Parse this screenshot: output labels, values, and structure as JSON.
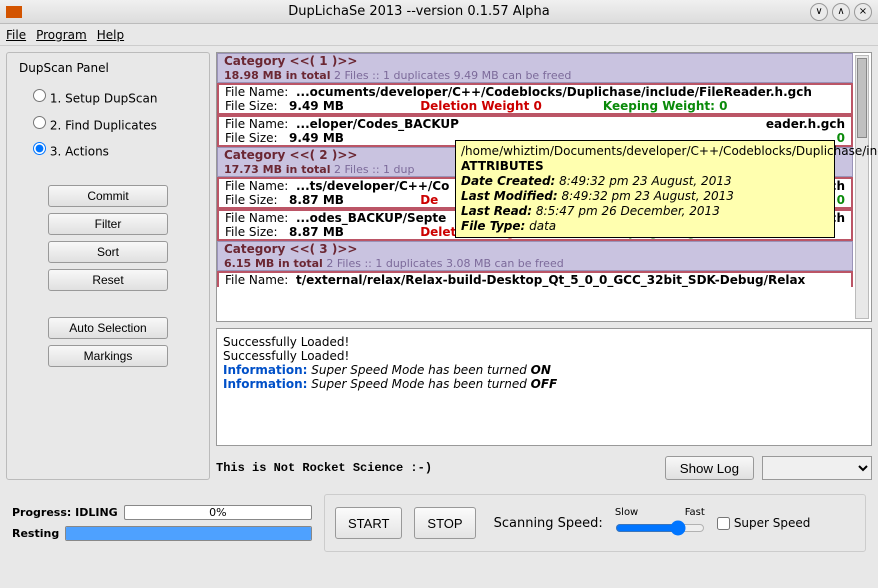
{
  "window": {
    "title": "DupLichaSe 2013 --version 0.1.57 Alpha"
  },
  "menu": {
    "file": "File",
    "program": "Program",
    "help": "Help"
  },
  "sidebar": {
    "title": "DupScan Panel",
    "r1": "1. Setup DupScan",
    "r2": "2. Find Duplicates",
    "r3": "3. Actions",
    "commit": "Commit",
    "filter": "Filter",
    "sort": "Sort",
    "reset": "Reset",
    "auto": "Auto Selection",
    "markings": "Markings"
  },
  "results": {
    "cat1_head": "Category <<( 1 )>>",
    "cat1_total": "18.98 MB in total",
    "cat1_tail": "  2 Files ::  1 duplicates   9.49 MB can be freed",
    "row1_path": "...ocuments/developer/C++/Codeblocks/Duplichase/include/FileReader.h.gch",
    "row1_size": "9.49 MB",
    "row2_path": "...eloper/Codes_BACKUP",
    "row2_size": "9.49 MB",
    "row2_tail": "eader.h.gch",
    "cat2_head": "Category <<( 2 )>>",
    "cat2_total": "17.73 MB in total",
    "cat2_tail": "  2 Files ::  1 dup",
    "row3_path": "...ts/developer/C++/Co",
    "row3_size": "8.87 MB",
    "row3_tail": "hash.h.gch",
    "row4_path": "...odes_BACKUP/Septe",
    "row4_size": "8.87 MB",
    "row4_tail": "hash.h.gch",
    "cat3_head": "Category <<( 3 )>>",
    "cat3_total": "6.15 MB in total",
    "cat3_tail": "  2 Files ::  1 duplicates   3.08 MB can be freed",
    "row5_path": "t/external/relax/Relax-build-Desktop_Qt_5_0_0_GCC_32bit_SDK-Debug/Relax",
    "filename_label": "File Name:",
    "filesize_label": "File Size:",
    "delw": "Deletion Weight  0",
    "keepw": "Keeping Weight:  0"
  },
  "log": {
    "l1": "Successfully Loaded!",
    "l2": "Successfully Loaded!",
    "info_label": "Information:",
    "i1": " Super Speed Mode has been turned ",
    "on": "ON",
    "i2": " Super Speed Mode has been turned ",
    "off": "OFF",
    "tagline": "This is Not Rocket Science :-)",
    "showlog": "Show Log"
  },
  "bottom": {
    "progress_label": "Progress: IDLING",
    "progress_pct": "0%",
    "resting": "Resting",
    "start": "START",
    "stop": "STOP",
    "speed_label": "Scanning Speed:",
    "slow": "Slow",
    "fast": "Fast",
    "superspeed": "Super Speed"
  },
  "tooltip": {
    "path": "/home/whiztim/Documents/developer/C++/Codeblocks/Duplichase/include/FileReader.h.gch",
    "attrs": "ATTRIBUTES",
    "dc_l": "Date Created:",
    "dc_v": " 8:49:32 pm 23 August, 2013",
    "lm_l": "Last Modified:",
    "lm_v": " 8:49:32 pm 23 August, 2013",
    "lr_l": "Last Read:",
    "lr_v": " 8:5:47 pm 26 December, 2013",
    "ft_l": "File Type:",
    "ft_v": " data"
  }
}
